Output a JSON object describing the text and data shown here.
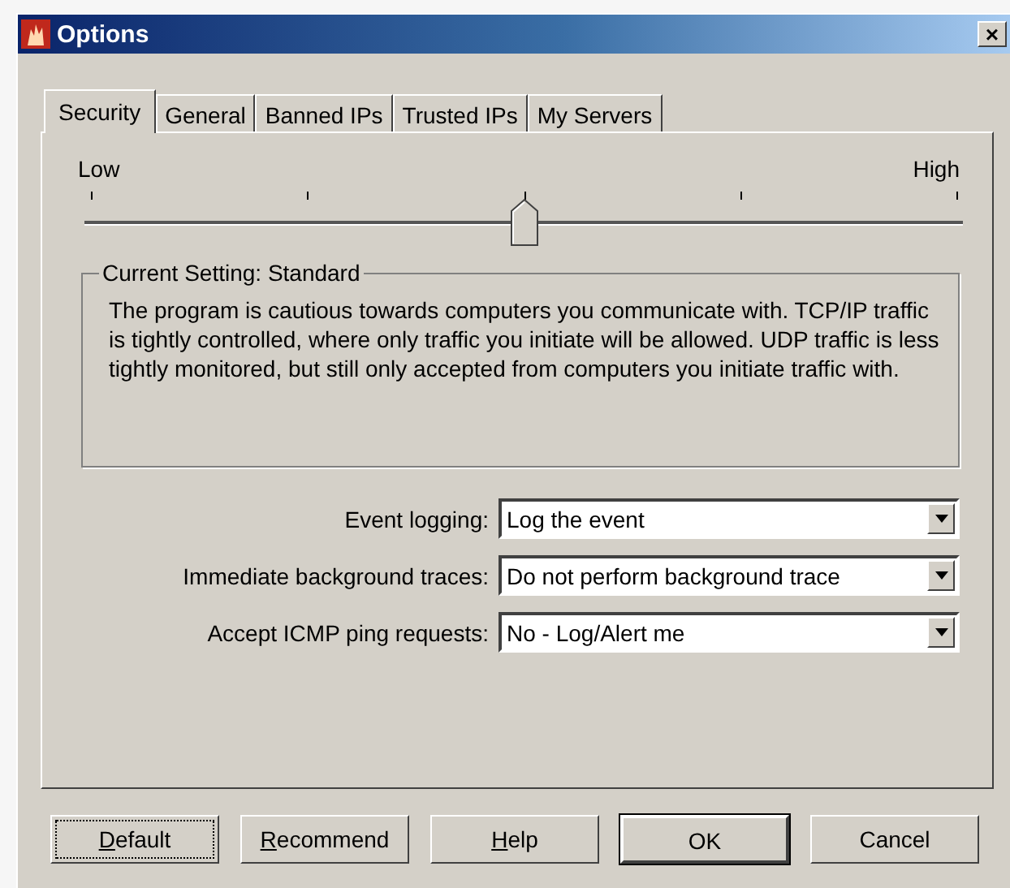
{
  "window": {
    "title": "Options",
    "close": "×"
  },
  "tabs": [
    {
      "label": "Security",
      "selected": true
    },
    {
      "label": "General",
      "selected": false
    },
    {
      "label": "Banned IPs",
      "selected": false
    },
    {
      "label": "Trusted IPs",
      "selected": false
    },
    {
      "label": "My Servers",
      "selected": false
    }
  ],
  "slider": {
    "low_label": "Low",
    "high_label": "High",
    "level": 0.5
  },
  "current_setting": {
    "title": "Current Setting: Standard",
    "description": "The program is cautious towards computers you communicate with. TCP/IP traffic is tightly controlled, where only traffic you initiate will be allowed.  UDP traffic is less tightly monitored, but still only accepted from computers you initiate traffic with."
  },
  "settings": [
    {
      "label": "Event logging:",
      "value": "Log the event"
    },
    {
      "label": "Immediate background traces:",
      "value": "Do not perform background trace"
    },
    {
      "label": "Accept ICMP ping requests:",
      "value": "No - Log/Alert me"
    }
  ],
  "buttons": [
    {
      "label": "Default",
      "mnemonic": true,
      "focused": true,
      "default": false
    },
    {
      "label": "Recommend",
      "mnemonic": true,
      "focused": false,
      "default": false
    },
    {
      "label": "Help",
      "mnemonic": true,
      "focused": false,
      "default": false
    },
    {
      "label": "OK",
      "mnemonic": false,
      "focused": false,
      "default": true
    },
    {
      "label": "Cancel",
      "mnemonic": false,
      "focused": false,
      "default": false
    }
  ]
}
